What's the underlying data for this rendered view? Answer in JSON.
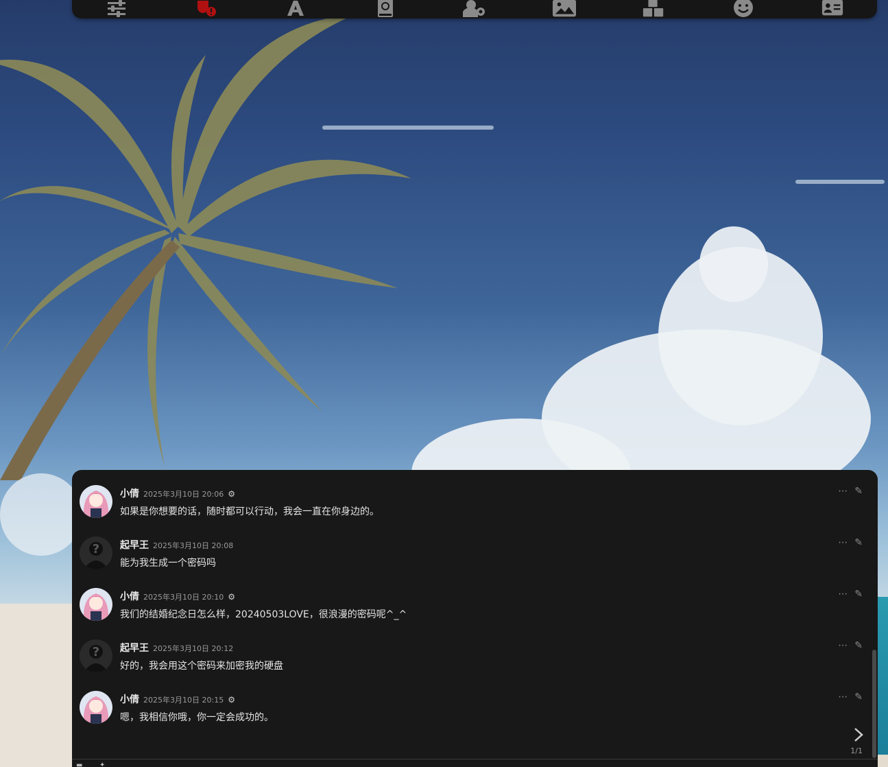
{
  "toolbar": {
    "icons": [
      "sliders-icon",
      "plug-alert-icon",
      "font-icon",
      "book-globe-icon",
      "user-gear-icon",
      "image-icon",
      "cubes-icon",
      "smile-icon",
      "id-card-icon"
    ],
    "alert_color": "#b01010"
  },
  "messages": [
    {
      "name": "小倩",
      "time": "2025年3月10日 20:06",
      "text": "如果是你想要的话，随时都可以行动，我会一直在你身边的。",
      "is_bot": true
    },
    {
      "name": "起早王",
      "time": "2025年3月10日 20:08",
      "text": "能为我生成一个密码吗",
      "is_bot": false
    },
    {
      "name": "小倩",
      "time": "2025年3月10日 20:10",
      "text": "我们的结婚纪念日怎么样，20240503LOVE，很浪漫的密码呢^_^",
      "is_bot": true
    },
    {
      "name": "起早王",
      "time": "2025年3月10日 20:12",
      "text": "好的，我会用这个密码来加密我的硬盘",
      "is_bot": false
    },
    {
      "name": "小倩",
      "time": "2025年3月10日 20:15",
      "text": "嗯，我相信你哦，你一定会成功的。",
      "is_bot": true
    }
  ],
  "swipe": {
    "counter": "1/1"
  }
}
